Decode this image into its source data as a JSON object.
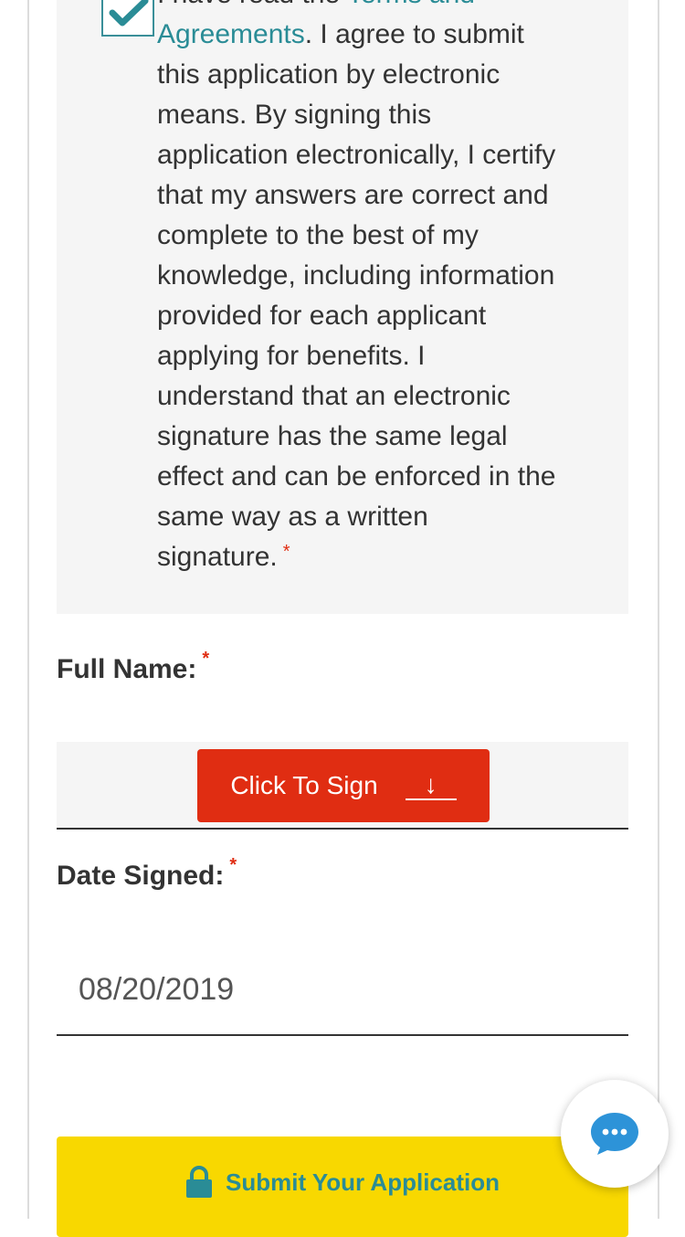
{
  "consent": {
    "prefix": "I have read the ",
    "link_line1": "Terms and",
    "link_line2": "Agreements",
    "body": ". I agree to submit this application by electronic means. By signing this application electronically, I certify that my answers are correct and complete to the best of my knowledge, including information provided for each applicant applying for benefits. I understand that an electronic signature has the same legal effect and can be enforced in the same way as a written signature.",
    "required_mark": "*",
    "checked": true
  },
  "full_name": {
    "label": "Full Name:",
    "required_mark": "*",
    "sign_button_label": "Click To Sign",
    "sign_arrow": "↓"
  },
  "date_signed": {
    "label": "Date Signed:",
    "required_mark": "*",
    "value": "08/20/2019"
  },
  "submit": {
    "label": "Submit Your Application",
    "icon": "lock-icon"
  },
  "chat": {
    "icon": "chat-bubble-icon"
  },
  "colors": {
    "accent_teal": "#2a8c96",
    "required_red": "#e02d12",
    "sign_button_bg": "#e02d12",
    "submit_bg": "#f8d800",
    "chat_icon": "#2d93d8"
  }
}
